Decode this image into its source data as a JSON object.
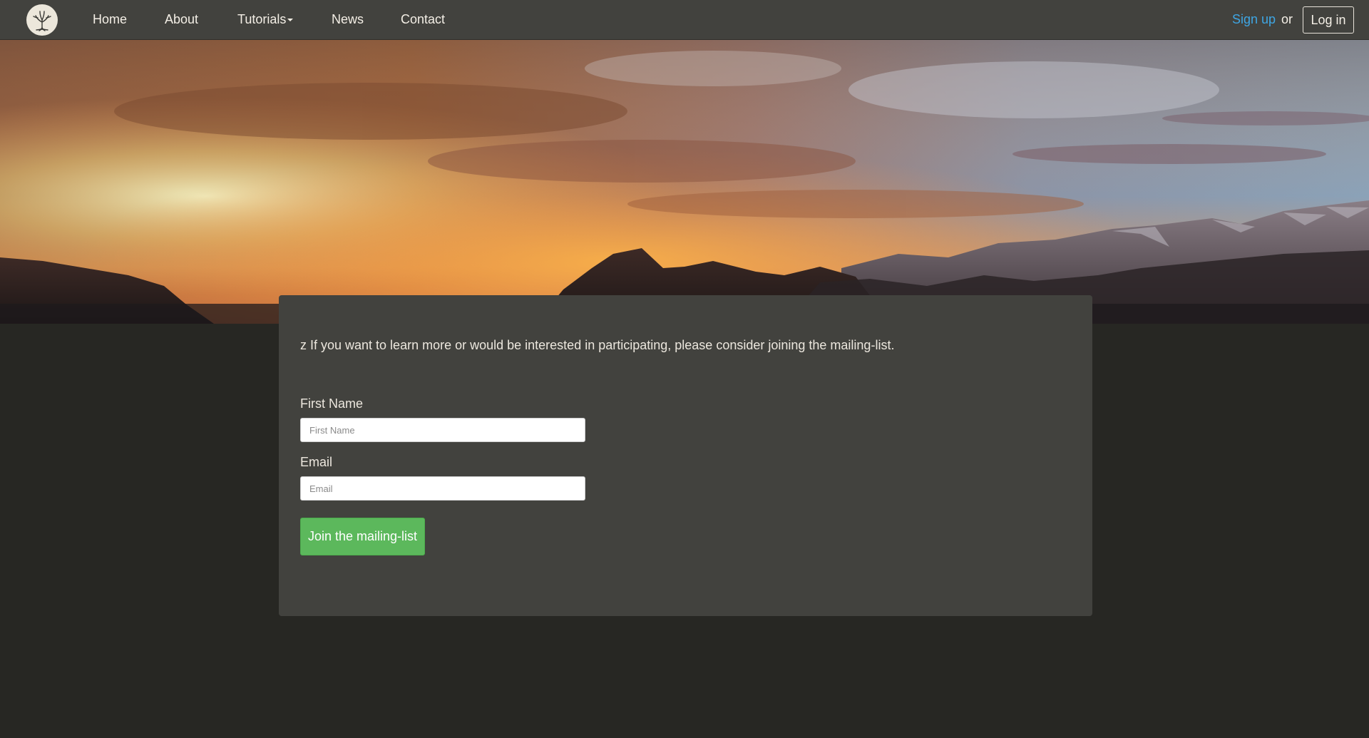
{
  "nav": {
    "logo_icon": "tree-icon",
    "links": [
      {
        "label": "Home"
      },
      {
        "label": "About"
      },
      {
        "label": "Tutorials"
      },
      {
        "label": "News"
      },
      {
        "label": "Contact"
      }
    ],
    "signup_label": "Sign up",
    "or_text": "or",
    "login_label": "Log in"
  },
  "hero": {
    "image": "sunset-mountains-banner"
  },
  "main": {
    "intro": "z If you want to learn more or would be interested in participating, please consider joining the mailing-list.",
    "form": {
      "first_name_label": "First Name",
      "first_name_placeholder": "First Name",
      "first_name_value": "",
      "email_label": "Email",
      "email_placeholder": "Email",
      "email_value": "",
      "submit_label": "Join the mailing-list"
    }
  },
  "colors": {
    "navbar": "#42423e",
    "page_bg": "#272723",
    "card_bg": "#42423e",
    "link_accent": "#3ea6e4",
    "button_green": "#5cb85c"
  }
}
